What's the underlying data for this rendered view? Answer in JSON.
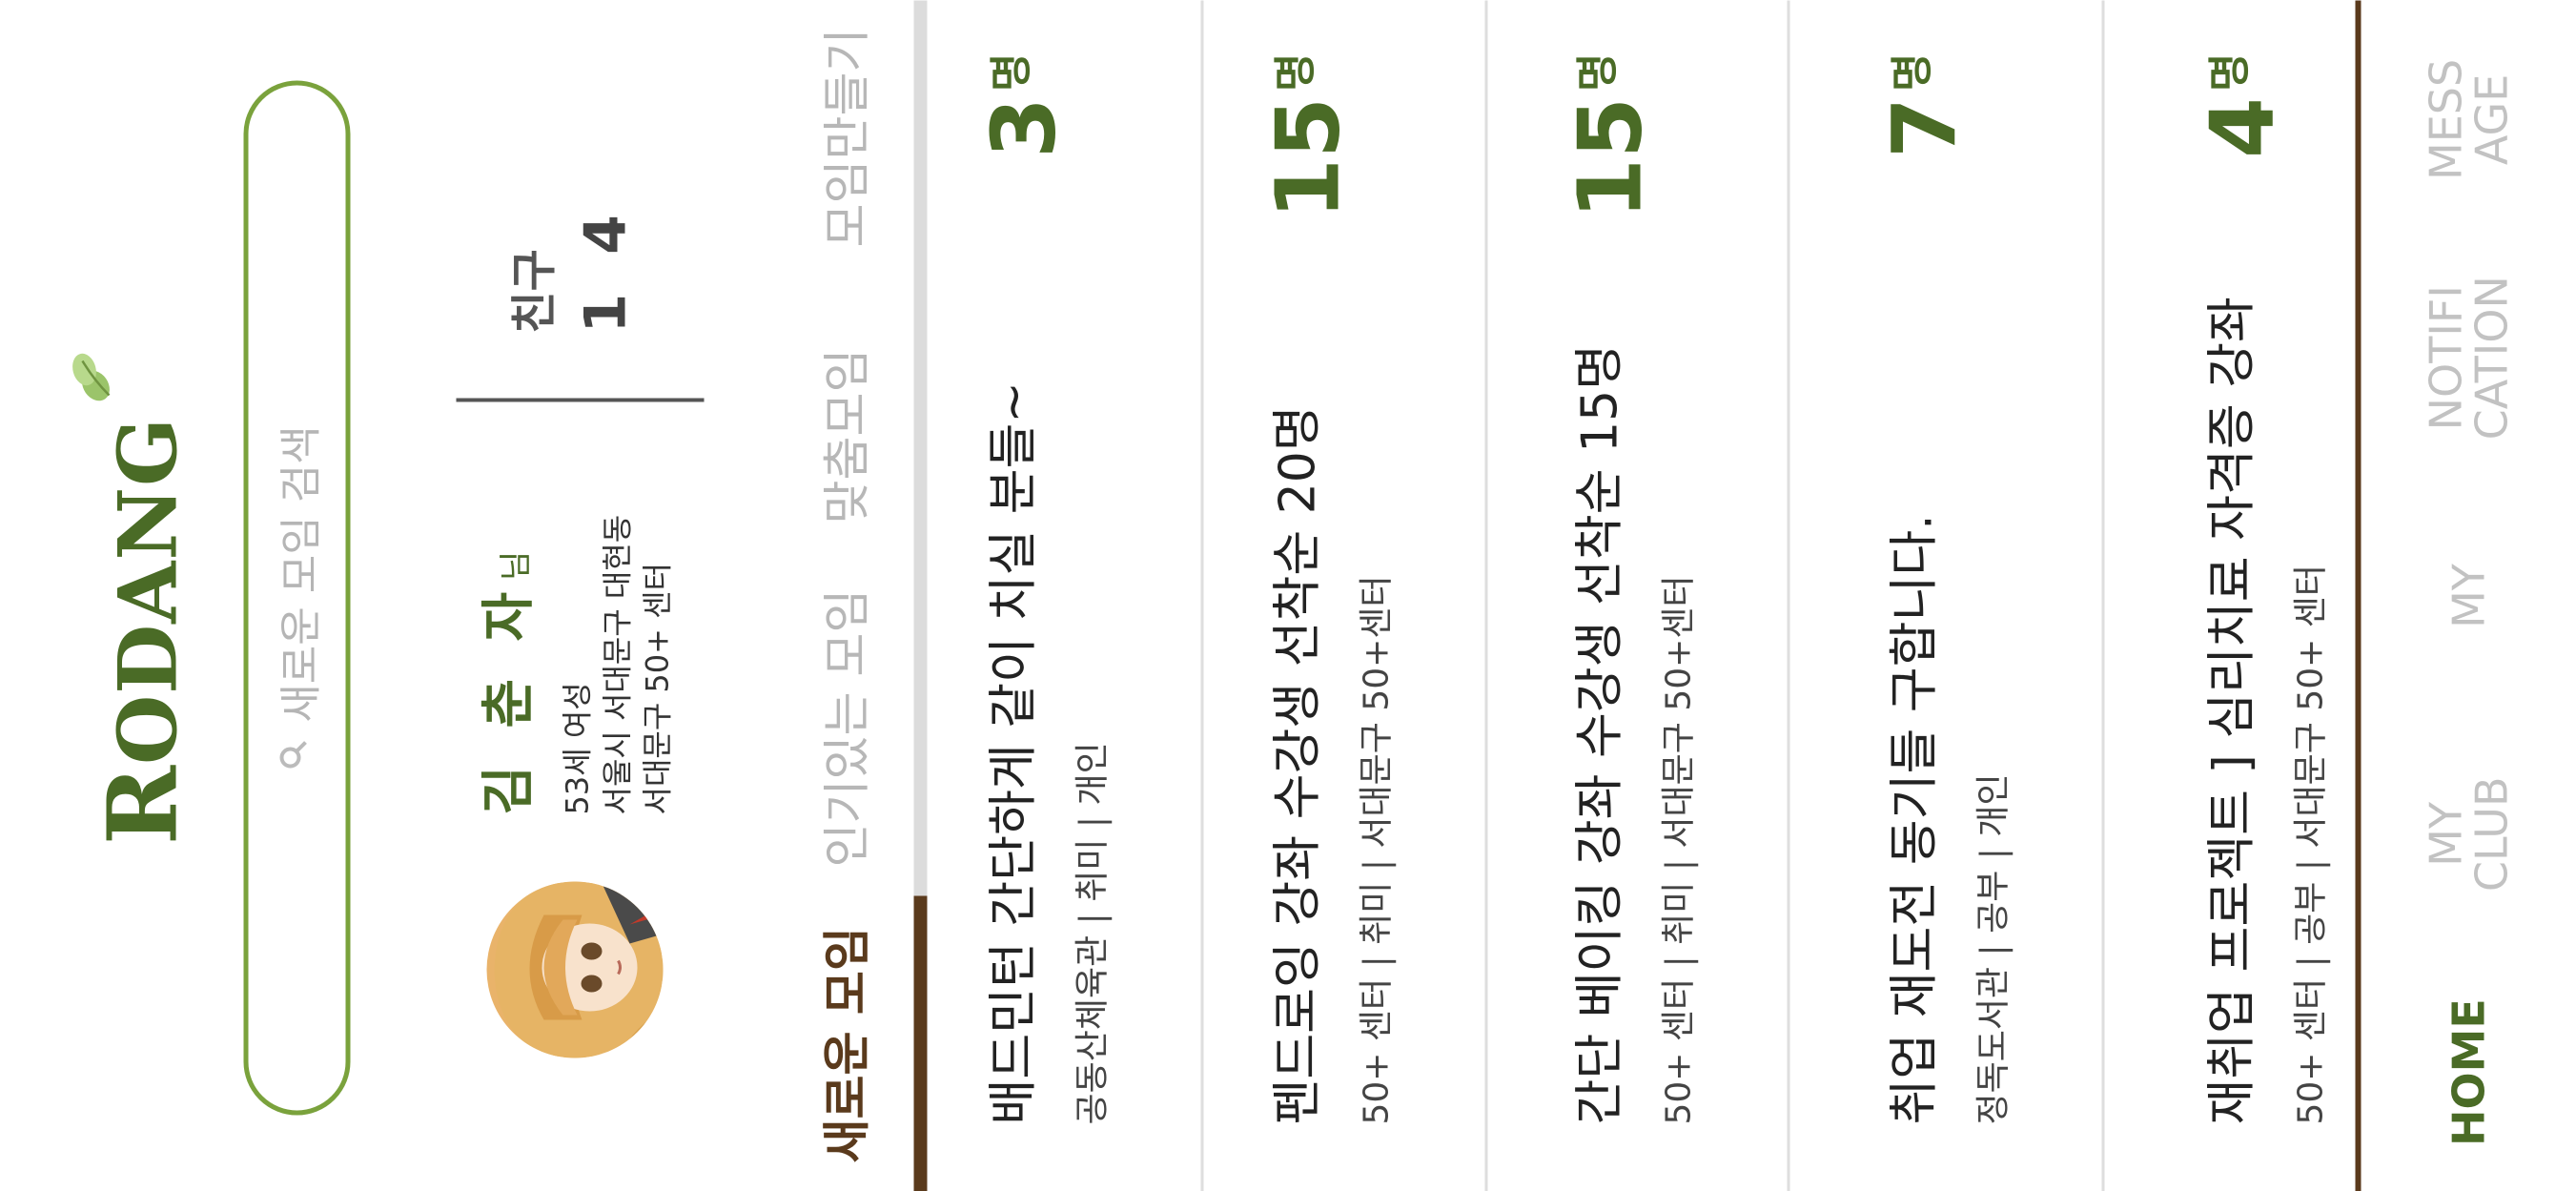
{
  "header": {
    "logo": "RODANG"
  },
  "search": {
    "placeholder": "새로운 모임 검색"
  },
  "profile": {
    "name": "김 춘 자",
    "honorific": "님",
    "age_gender": "53세 여성",
    "address": "서울시 서대문구 대현동",
    "center": "서대문구 50+ 센터"
  },
  "friends": {
    "label": "친구",
    "count": "1 4"
  },
  "tabs": [
    "새로운 모임",
    "인기있는 모임",
    "맞춤모임",
    "모임만들기"
  ],
  "clubs": [
    {
      "title": "배드민턴 간단하게 같이 치실 분들~",
      "subtitle": "공동산체육관  |  취미  |  개인",
      "count": "3",
      "unit": "명"
    },
    {
      "title": "펜드로잉 강좌 수강생 선착순 20명",
      "subtitle": "50+ 센터  |  취미  |  서대문구 50+센터",
      "count": "15",
      "unit": "명"
    },
    {
      "title": "간단 베이킹 강좌 수강생 선착순 15명",
      "subtitle": "50+ 센터  |  취미  |  서대문구 50+센터",
      "count": "15",
      "unit": "명"
    },
    {
      "title": "취업 재도전 동기들 구합니다.",
      "subtitle": "정독도서관  |  공부  |  개인",
      "count": "7",
      "unit": "명"
    },
    {
      "title": "재취업 프로젝트 ] 심리치료 자격증 강좌",
      "subtitle": "50+ 센터  |  공부  |  서대문구 50+ 센터",
      "count": "4",
      "unit": "명"
    }
  ],
  "nav": [
    "HOME",
    "MY\nCLUB",
    "MY",
    "NOTIFI\nCATION",
    "MESS\nAGE"
  ],
  "colors": {
    "primary_green": "#4a6b26",
    "search_border": "#7aa23c",
    "brown": "#5a3a1c",
    "inactive": "#b7b7b7"
  }
}
